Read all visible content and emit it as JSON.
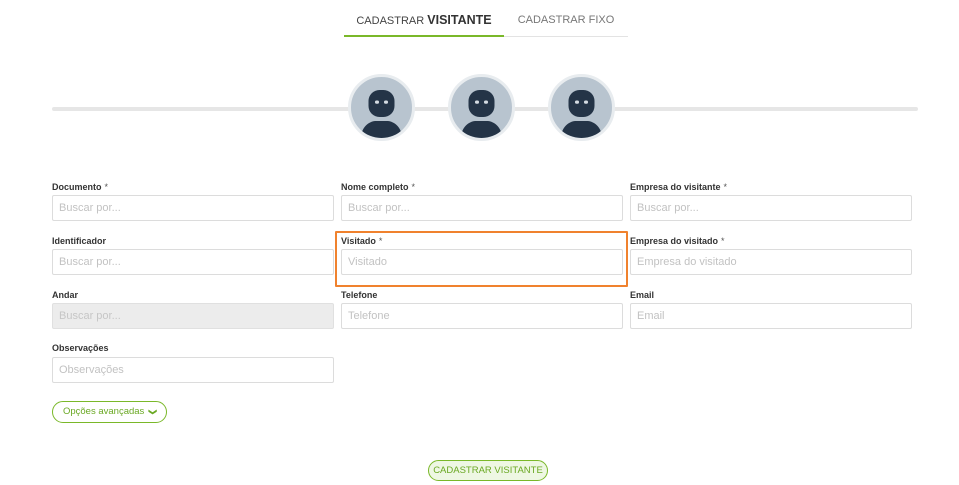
{
  "tabs": {
    "visitante_prefix": "CADASTRAR",
    "visitante_strong": "VISITANTE",
    "fixo": "CADASTRAR FIXO"
  },
  "avatars": [
    {
      "icon": "user-avatar-icon"
    },
    {
      "icon": "user-avatar-icon"
    },
    {
      "icon": "user-avatar-icon"
    }
  ],
  "form": {
    "documento": {
      "label": "Documento",
      "required": "*",
      "placeholder": "Buscar por..."
    },
    "nome": {
      "label": "Nome completo",
      "required": "*",
      "placeholder": "Buscar por..."
    },
    "empresa_visitante": {
      "label": "Empresa do visitante",
      "required": "*",
      "placeholder": "Buscar por..."
    },
    "identificador": {
      "label": "Identificador",
      "placeholder": "Buscar por..."
    },
    "visitado": {
      "label": "Visitado",
      "required": "*",
      "placeholder": "Visitado"
    },
    "empresa_visitado": {
      "label": "Empresa do visitado",
      "required": "*",
      "placeholder": "Empresa do visitado"
    },
    "andar": {
      "label": "Andar",
      "placeholder": "Buscar por..."
    },
    "telefone": {
      "label": "Telefone",
      "placeholder": "Telefone"
    },
    "email": {
      "label": "Email",
      "placeholder": "Email"
    },
    "observacoes": {
      "label": "Observações",
      "placeholder": "Observações"
    }
  },
  "buttons": {
    "advanced": "Opções avançadas",
    "advanced_icon": "chevron-down-icon",
    "submit": "CADASTRAR VISITANTE"
  },
  "colors": {
    "accent": "#7ab829",
    "highlight": "#f0822e",
    "avatar_bg": "#b8c4cf",
    "avatar_figure": "#243447"
  }
}
